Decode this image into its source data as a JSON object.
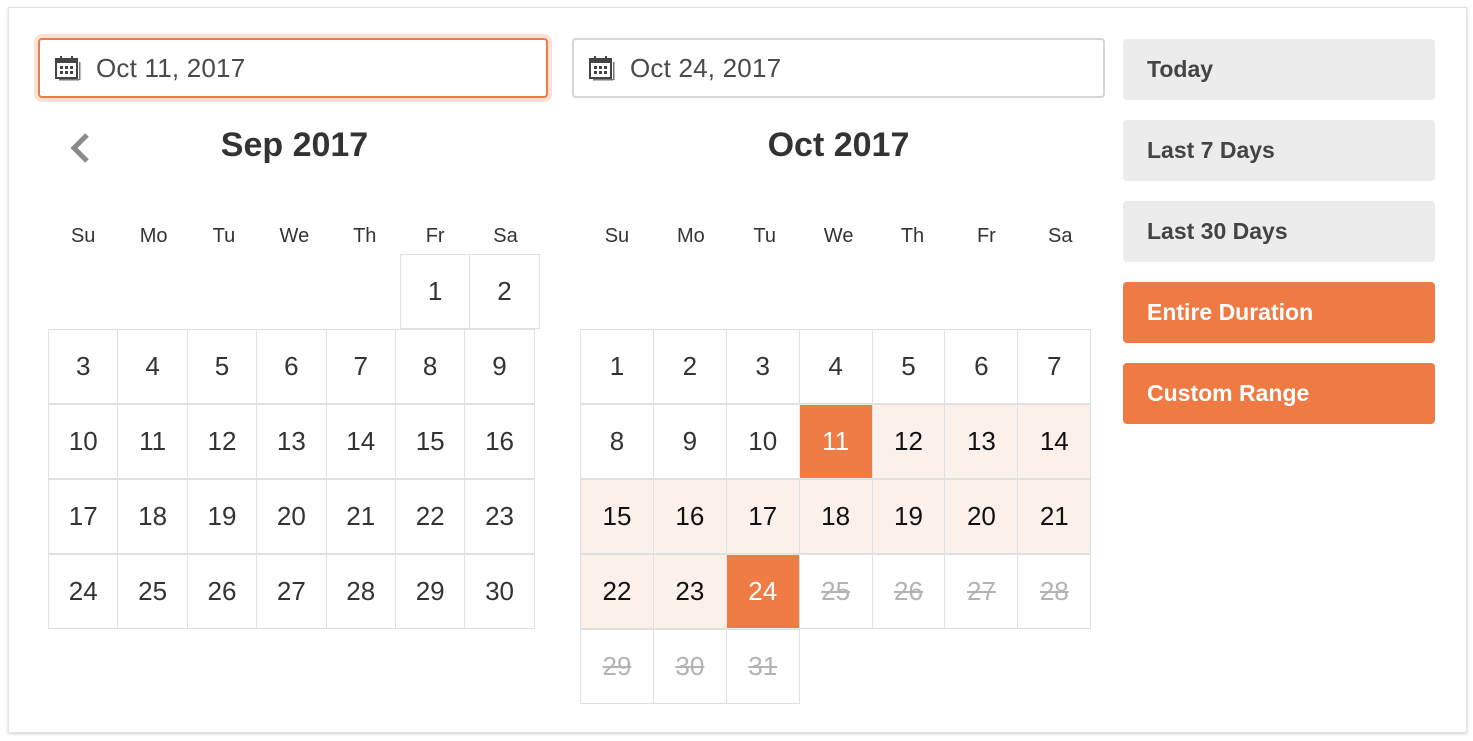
{
  "start_date": {
    "value": "Oct 11, 2017",
    "icon": "calendar-icon",
    "active": true
  },
  "end_date": {
    "value": "Oct 24, 2017",
    "icon": "calendar-icon",
    "active": false
  },
  "nav": {
    "prev_icon": "chevron-left-icon"
  },
  "colors": {
    "accent": "#f07c45",
    "range_fill": "#fcf0ea",
    "preset_bg": "#ececec",
    "disabled_text": "#b3b3b3"
  },
  "weekdays": [
    "Su",
    "Mo",
    "Tu",
    "We",
    "Th",
    "Fr",
    "Sa"
  ],
  "calendars": [
    {
      "title": "Sep 2017",
      "weeks": [
        [
          null,
          null,
          null,
          null,
          null,
          {
            "d": "1"
          },
          {
            "d": "2"
          }
        ],
        [
          {
            "d": "3"
          },
          {
            "d": "4"
          },
          {
            "d": "5"
          },
          {
            "d": "6"
          },
          {
            "d": "7"
          },
          {
            "d": "8"
          },
          {
            "d": "9"
          }
        ],
        [
          {
            "d": "10"
          },
          {
            "d": "11"
          },
          {
            "d": "12"
          },
          {
            "d": "13"
          },
          {
            "d": "14"
          },
          {
            "d": "15"
          },
          {
            "d": "16"
          }
        ],
        [
          {
            "d": "17"
          },
          {
            "d": "18"
          },
          {
            "d": "19"
          },
          {
            "d": "20"
          },
          {
            "d": "21"
          },
          {
            "d": "22"
          },
          {
            "d": "23"
          }
        ],
        [
          {
            "d": "24"
          },
          {
            "d": "25"
          },
          {
            "d": "26"
          },
          {
            "d": "27"
          },
          {
            "d": "28"
          },
          {
            "d": "29"
          },
          {
            "d": "30"
          }
        ]
      ]
    },
    {
      "title": "Oct 2017",
      "weeks": [
        [
          null,
          null,
          null,
          null,
          null,
          null,
          null
        ],
        [
          {
            "d": "1"
          },
          {
            "d": "2"
          },
          {
            "d": "3"
          },
          {
            "d": "4"
          },
          {
            "d": "5"
          },
          {
            "d": "6"
          },
          {
            "d": "7"
          }
        ],
        [
          {
            "d": "8"
          },
          {
            "d": "9"
          },
          {
            "d": "10"
          },
          {
            "d": "11",
            "s": "selected"
          },
          {
            "d": "12",
            "s": "in-range"
          },
          {
            "d": "13",
            "s": "in-range"
          },
          {
            "d": "14",
            "s": "in-range"
          }
        ],
        [
          {
            "d": "15",
            "s": "in-range"
          },
          {
            "d": "16",
            "s": "in-range"
          },
          {
            "d": "17",
            "s": "in-range"
          },
          {
            "d": "18",
            "s": "in-range"
          },
          {
            "d": "19",
            "s": "in-range"
          },
          {
            "d": "20",
            "s": "in-range"
          },
          {
            "d": "21",
            "s": "in-range"
          }
        ],
        [
          {
            "d": "22",
            "s": "in-range"
          },
          {
            "d": "23",
            "s": "in-range"
          },
          {
            "d": "24",
            "s": "selected"
          },
          {
            "d": "25",
            "s": "disabled"
          },
          {
            "d": "26",
            "s": "disabled"
          },
          {
            "d": "27",
            "s": "disabled"
          },
          {
            "d": "28",
            "s": "disabled"
          }
        ],
        [
          {
            "d": "29",
            "s": "disabled"
          },
          {
            "d": "30",
            "s": "disabled"
          },
          {
            "d": "31",
            "s": "disabled"
          },
          null,
          null,
          null,
          null
        ]
      ]
    }
  ],
  "presets": [
    {
      "label": "Today",
      "style": "default"
    },
    {
      "label": "Last 7 Days",
      "style": "default"
    },
    {
      "label": "Last 30 Days",
      "style": "default"
    },
    {
      "label": "Entire Duration",
      "style": "accent"
    },
    {
      "label": "Custom Range",
      "style": "accent"
    }
  ]
}
